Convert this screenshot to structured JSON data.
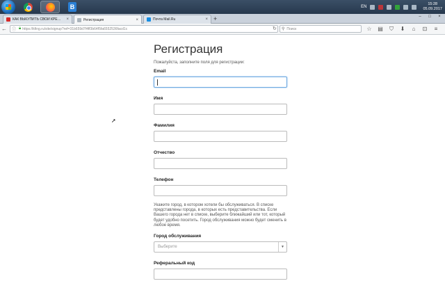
{
  "taskbar": {
    "lang": "EN",
    "time": "15:28",
    "date": "05.09.2017"
  },
  "tabs": [
    {
      "label": "КАК ВЫКУПИТЬ СВОЙ КРЕ…",
      "favicon_color": "#d62828"
    },
    {
      "label": "Регистрация",
      "favicon_color": "#9aa"
    },
    {
      "label": "Почта Mail.Ru",
      "favicon_color": "#168de2"
    }
  ],
  "navbar": {
    "url": "https://kfing.ru/site/signup?ref=31b659d7f4ff3b64f5fa6552536facd1c",
    "search_placeholder": "Поиск"
  },
  "form": {
    "title": "Регистрация",
    "subtitle": "Пожалуйста, заполните поля для регистрации:",
    "fields": {
      "email": "Email",
      "name": "Имя",
      "surname": "Фамилия",
      "patronymic": "Отчество",
      "phone": "Телефон"
    },
    "city_hint": "Укажите город, в котором хотели бы обслуживаться. В списке представлены города, в которых есть представительства. Если Вашего города нет в списке, выберите ближайший или тот, который будет удобно посетить. Город обслуживания можно будет сменить в любое время.",
    "city_label": "Город обслуживания",
    "city_select": "Выберите",
    "referral_label": "Реферальный код"
  }
}
